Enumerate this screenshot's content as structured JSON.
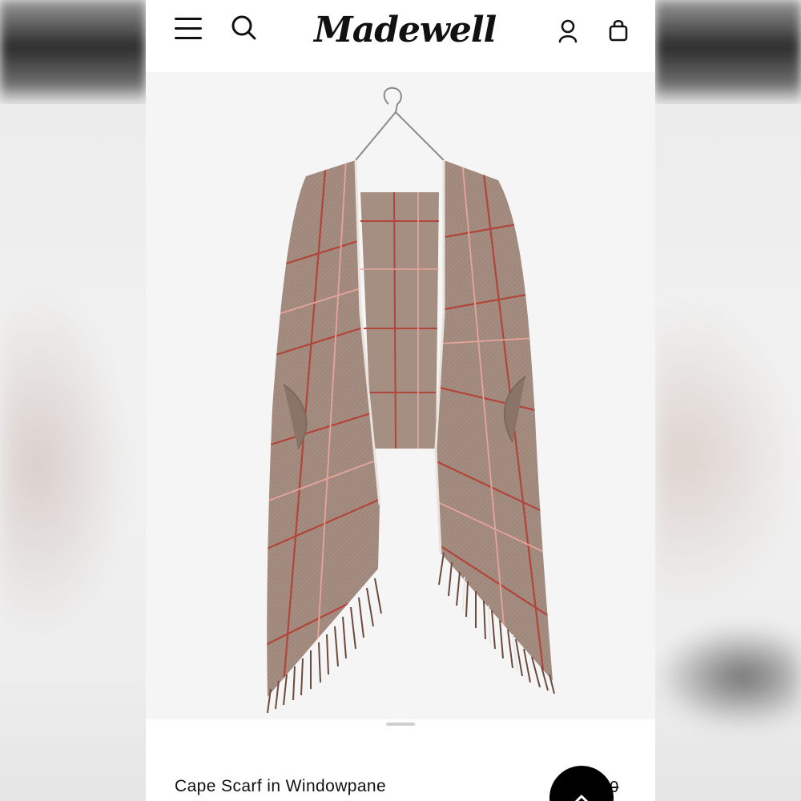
{
  "header": {
    "brand": "Madewell",
    "icons": {
      "menu": "hamburger-menu-icon",
      "search": "search-icon",
      "account": "user-icon",
      "bag": "shopping-bag-icon"
    }
  },
  "product": {
    "name": "Cape Scarf in Windowpane",
    "price_visible": "50"
  },
  "colors": {
    "scarf_base": "#a48d80",
    "windowpane_red": "#b2443a",
    "windowpane_pink": "#e8a39a",
    "scroll_button": "#000000"
  }
}
